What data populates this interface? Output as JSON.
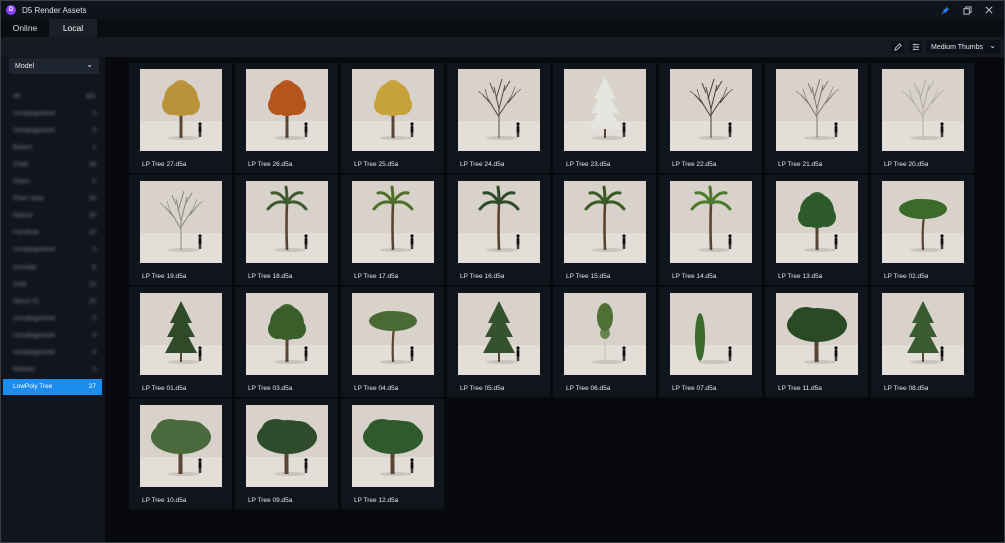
{
  "window": {
    "title": "D5 Render Assets",
    "logo_letter": "D"
  },
  "tabs": [
    {
      "label": "Online",
      "active": false
    },
    {
      "label": "Local",
      "active": true
    }
  ],
  "toolbar": {
    "view_mode": "Medium Thumbs"
  },
  "sidebar": {
    "filter": "Model",
    "categories": [
      {
        "label": "All",
        "count": "161"
      },
      {
        "label": "Uncategorized",
        "count": "0"
      },
      {
        "label": "Uncategorized",
        "count": "0"
      },
      {
        "label": "Basics",
        "count": "1"
      },
      {
        "label": "Chair",
        "count": "28"
      },
      {
        "label": "Glass",
        "count": "0"
      },
      {
        "label": "Plant Vase",
        "count": "33"
      },
      {
        "label": "Nature",
        "count": "15"
      },
      {
        "label": "Furniture",
        "count": "10"
      },
      {
        "label": "Uncategorized",
        "count": "0"
      },
      {
        "label": "Ironclad",
        "count": "6"
      },
      {
        "label": "Sofa",
        "count": "15"
      },
      {
        "label": "Decor 01",
        "count": "20"
      },
      {
        "label": "Uncategorized",
        "count": "0"
      },
      {
        "label": "Uncategorized",
        "count": "0"
      },
      {
        "label": "Uncategorized",
        "count": "0"
      },
      {
        "label": "Kitchen",
        "count": "0"
      },
      {
        "label": "LowPoly Tree",
        "count": "27",
        "active": true
      }
    ]
  },
  "colors": {
    "accent": "#1b8cf0",
    "background": "#07090d",
    "sidebar": "#10151e",
    "card": "#10151d",
    "pin": "#2f7df6"
  },
  "assets": [
    {
      "name": "LP Tree 27.d5a",
      "kind": "round",
      "color": "#b9923a"
    },
    {
      "name": "LP Tree 26.d5a",
      "kind": "round",
      "color": "#b5541c"
    },
    {
      "name": "LP Tree 25.d5a",
      "kind": "round",
      "color": "#c7a23a"
    },
    {
      "name": "LP Tree 24.d5a",
      "kind": "bare",
      "color": "#5a4a3c"
    },
    {
      "name": "LP Tree 23.d5a",
      "kind": "conifer",
      "color": "#e6e6e0"
    },
    {
      "name": "LP Tree 22.d5a",
      "kind": "bare",
      "color": "#4a3e34"
    },
    {
      "name": "LP Tree 21.d5a",
      "kind": "bare",
      "color": "#7e7670"
    },
    {
      "name": "LP Tree 20.d5a",
      "kind": "bare",
      "color": "#b2aca6"
    },
    {
      "name": "LP Tree 19.d5a",
      "kind": "bare",
      "color": "#8a8580"
    },
    {
      "name": "LP Tree 18.d5a",
      "kind": "palm",
      "color": "#3f5a2e"
    },
    {
      "name": "LP Tree 17.d5a",
      "kind": "palm",
      "color": "#4f6e2a"
    },
    {
      "name": "LP Tree 16.d5a",
      "kind": "palm",
      "color": "#2f4a2a"
    },
    {
      "name": "LP Tree 15.d5a",
      "kind": "palm",
      "color": "#3a5a24"
    },
    {
      "name": "LP Tree 14.d5a",
      "kind": "palm",
      "color": "#4a7a2a"
    },
    {
      "name": "LP Tree 13.d5a",
      "kind": "round",
      "color": "#2c5a2a"
    },
    {
      "name": "LP Tree 02.d5a",
      "kind": "umbrella",
      "color": "#3c6a2a"
    },
    {
      "name": "LP Tree 01.d5a",
      "kind": "conifer",
      "color": "#2e4a28"
    },
    {
      "name": "LP Tree 03.d5a",
      "kind": "round",
      "color": "#3a5e2a"
    },
    {
      "name": "LP Tree 04.d5a",
      "kind": "umbrella",
      "color": "#4a6a34"
    },
    {
      "name": "LP Tree 05.d5a",
      "kind": "conifer",
      "color": "#34522e"
    },
    {
      "name": "LP Tree 06.d5a",
      "kind": "slim",
      "color": "#4e7034"
    },
    {
      "name": "LP Tree 07.d5a",
      "kind": "cypress",
      "color": "#3a6a2c"
    },
    {
      "name": "LP Tree 11.d5a",
      "kind": "wide",
      "color": "#2a4a26"
    },
    {
      "name": "LP Tree 08.d5a",
      "kind": "conifer",
      "color": "#3a5a32"
    },
    {
      "name": "LP Tree 10.d5a",
      "kind": "wide",
      "color": "#4a6a3e"
    },
    {
      "name": "LP Tree 09.d5a",
      "kind": "wide",
      "color": "#2e4c2c"
    },
    {
      "name": "LP Tree 12.d5a",
      "kind": "wide",
      "color": "#2e5a2e"
    }
  ]
}
